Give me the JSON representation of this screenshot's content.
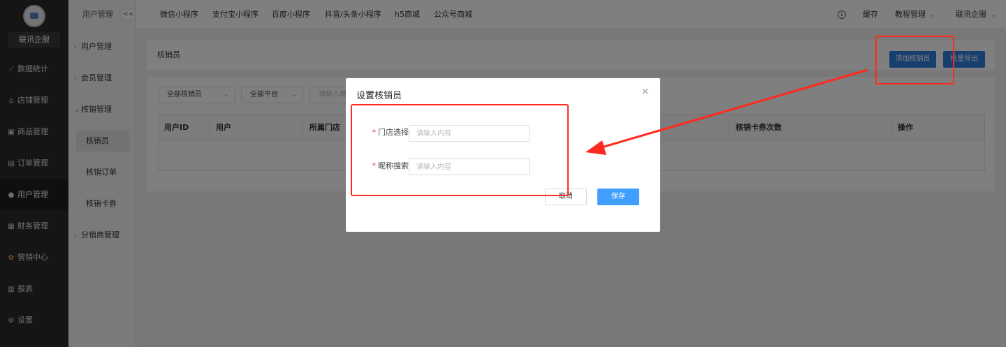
{
  "sidebar": {
    "brand": "联讯企服",
    "items": [
      {
        "icon": "chart-icon",
        "glyph": "⟋",
        "label": "数据统计"
      },
      {
        "icon": "shop-icon",
        "glyph": "⌂",
        "label": "店铺管理"
      },
      {
        "icon": "goods-icon",
        "glyph": "▣",
        "label": "商品管理"
      },
      {
        "icon": "order-icon",
        "glyph": "▤",
        "label": "订单管理"
      },
      {
        "icon": "user-icon",
        "glyph": "●",
        "label": "用户管理"
      },
      {
        "icon": "finance-icon",
        "glyph": "▦",
        "label": "财务管理"
      },
      {
        "icon": "marketing-icon",
        "glyph": "✿",
        "label": "营销中心"
      },
      {
        "icon": "report-icon",
        "glyph": "▥",
        "label": "报表"
      },
      {
        "icon": "settings-icon",
        "glyph": "⚙",
        "label": "设置"
      }
    ]
  },
  "submenu": {
    "header": "用户管理",
    "collapse": "<<",
    "groups": [
      {
        "label": "用户管理"
      },
      {
        "label": "会员管理"
      },
      {
        "label": "核销管理"
      },
      {
        "label": "分销商管理"
      }
    ],
    "leaves": [
      "核销员",
      "核销订单",
      "核销卡券"
    ]
  },
  "topbar": {
    "tabs": [
      "微信小程序",
      "支付宝小程序",
      "百度小程序",
      "抖音/头条小程序",
      "h5商城",
      "公众号商城"
    ],
    "cache": "缓存",
    "tutorial": "教程管理",
    "account": "联讯企服"
  },
  "content": {
    "title": "核销员",
    "add_button": "添加核销员",
    "export_button": "批量导出",
    "filters": {
      "verifier": "全部核销员",
      "platform": "全部平台",
      "search_placeholder": "请输入用"
    },
    "columns": [
      "用户ID",
      "用户",
      "所属门店",
      "核销卡券次数",
      "操作"
    ]
  },
  "dialog": {
    "title": "设置核销员",
    "required_mark": "*",
    "store_label": "门店选择",
    "store_placeholder": "请输入内容",
    "nickname_label": "昵称搜索",
    "nickname_placeholder": "请输入内容",
    "cancel": "取消",
    "save": "保存"
  },
  "colors": {
    "annotation": "#ff2a1f",
    "primary": "#409eff"
  }
}
